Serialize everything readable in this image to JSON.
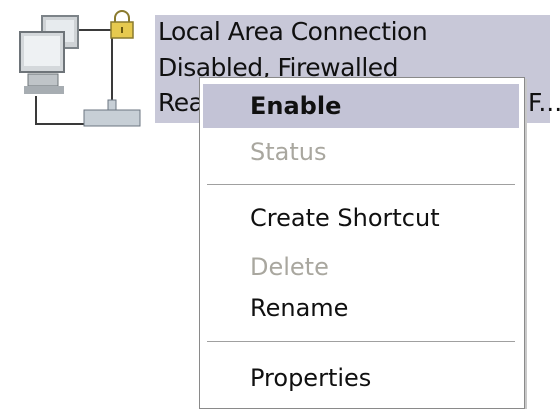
{
  "connection": {
    "name": "Local Area Connection",
    "status": "Disabled, Firewalled",
    "device_truncated": "Rea",
    "device_tail": "F..."
  },
  "context_menu": {
    "items": [
      {
        "label": "Enable",
        "state": "default"
      },
      {
        "label": "Status",
        "state": "disabled"
      },
      {
        "label": "Create Shortcut",
        "state": "normal"
      },
      {
        "label": "Delete",
        "state": "disabled"
      },
      {
        "label": "Rename",
        "state": "normal"
      },
      {
        "label": "Properties",
        "state": "normal"
      }
    ]
  },
  "colors": {
    "selection": "#c8c8d8",
    "menu_highlight": "#c3c3d6",
    "disabled_text": "#a9a79f"
  },
  "icons": {
    "connection": "network-connection-icon",
    "lock": "padlock-icon"
  }
}
